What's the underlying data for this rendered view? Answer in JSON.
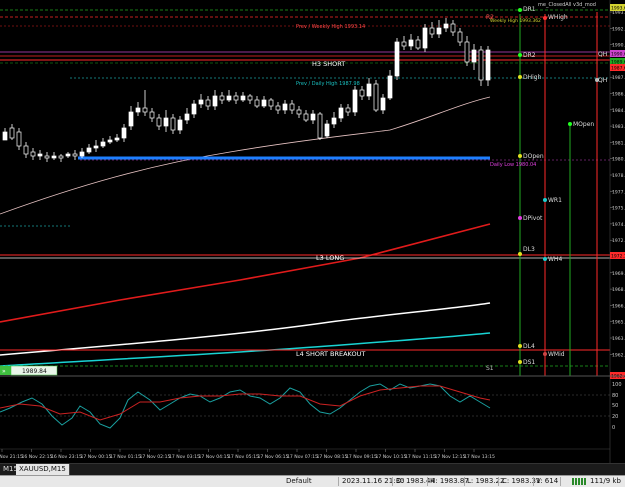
{
  "indicator_title": "me_ClosedAll v3d_mod",
  "price_axis": [
    "1993.6",
    "1992.1",
    "1990.6",
    "1989.1",
    "1987.6",
    "1986.1",
    "1984.6",
    "1983.1",
    "1981.6",
    "1980.1",
    "1978.6",
    "1977.1",
    "1975.6",
    "1974.1",
    "1972.6",
    "1971.1",
    "1969.6",
    "1968.1",
    "1966.6",
    "1965.1",
    "1963.6",
    "1962.1"
  ],
  "time_axis": [
    "16 Nov 21:15",
    "16 Nov 22:15",
    "16 Nov 23:15",
    "17 Nov 00:15",
    "17 Nov 01:15",
    "17 Nov 02:15",
    "17 Nov 03:15",
    "17 Nov 04:15",
    "17 Nov 05:15",
    "17 Nov 06:15",
    "17 Nov 07:15",
    "17 Nov 08:15",
    "17 Nov 09:15",
    "17 Nov 10:15",
    "17 Nov 11:15",
    "17 Nov 12:15",
    "17 Nov 13:15"
  ],
  "level_labels": {
    "dr1": "DR1",
    "r2": "R2",
    "whigh": "WHigh",
    "dr2": "DR2",
    "prev_weekly_high": "Prev / Weekly High 1993.14",
    "weekly_high": "Weekly High 1993.362",
    "h3_short": "H3 SHORT",
    "dhigh": "DHigh",
    "prev_daily_high": "Prev / Daily High 1987.98",
    "qh": "QH",
    "mopen": "MOpen",
    "dopen": "DOpen",
    "daily_low": "Daily Low 1980.04",
    "wr1": "WR1",
    "dpivot": "DPivot",
    "dl3": "DL3",
    "l3_long": "L3 LONG",
    "wh4": "WH4",
    "dl4": "DL4",
    "l4_short": "L4 SHORT BREAKOUT",
    "wmid": "WMid",
    "ds1": "DS1",
    "s1": "S1"
  },
  "price_badges": [
    "1993.6",
    "1990.6",
    "1989.6",
    "1987.6",
    "1972.1",
    "1962.4"
  ],
  "current_price_label": "1989.84",
  "oscillator_axis": [
    "100",
    "80",
    "50",
    "20",
    "0"
  ],
  "tabs": [
    "M15",
    "XAUUSD,M15"
  ],
  "status": {
    "profile": "Default",
    "datetime": "2023.11.16 21:30",
    "open": "O: 1983.44",
    "high": "H: 1983.87",
    "low": "L: 1983.22",
    "close": "C: 1983.31",
    "volume": "V: 614",
    "traffic": "111/9 kb"
  },
  "colors": {
    "background": "#000000",
    "bullish": "#ffffff",
    "bearish": "#000000",
    "level_red": "#ff2a2a",
    "level_green": "#22aa22",
    "ma_red": "#e01b1b",
    "ma_white": "#ffffff",
    "ma_cyan": "#19d3d3",
    "ma_pink": "#e7c3c3",
    "daily_low_blue": "#1e7fff",
    "osc_teal": "#1aa0a0",
    "osc_red": "#cc2222"
  }
}
